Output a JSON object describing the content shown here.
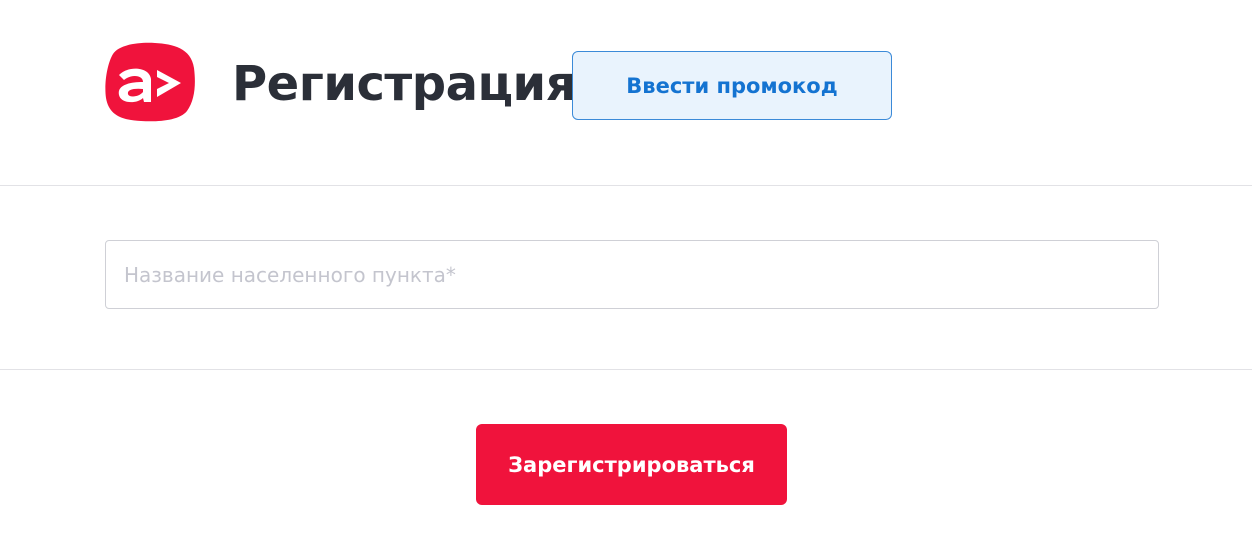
{
  "header": {
    "logo_icon": "brand-logo-icon",
    "title": "Регистрация",
    "promo_button_label": "Ввести промокод"
  },
  "form": {
    "city_input": {
      "value": "",
      "placeholder": "Название населенного пункта*"
    }
  },
  "footer": {
    "register_button_label": "Зарегистрироваться"
  },
  "colors": {
    "brand_red": "#f0133c",
    "promo_text": "#1473d1",
    "promo_bg": "#e9f3fd",
    "promo_border": "#3b8ad8",
    "title_text": "#2b2f38"
  }
}
